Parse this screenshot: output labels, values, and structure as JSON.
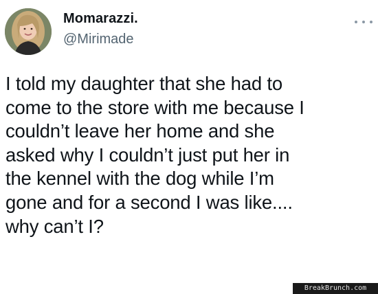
{
  "author": {
    "display_name": "Momarazzi.",
    "handle": "@Mirimade",
    "avatar_icon": "profile-photo"
  },
  "more_icon": "more-options-icon",
  "tweet": {
    "text": "I told my daughter that she had to\ncome to the store with me because I\ncouldn’t leave her home and she\nasked why I couldn’t just put her in\nthe kennel with the dog while I’m\ngone and for a second I was like....\nwhy can’t I?"
  },
  "watermark": {
    "text": "BreakBrunch.com"
  },
  "colors": {
    "text": "#0f1419",
    "handle": "#536471",
    "background": "#ffffff"
  }
}
